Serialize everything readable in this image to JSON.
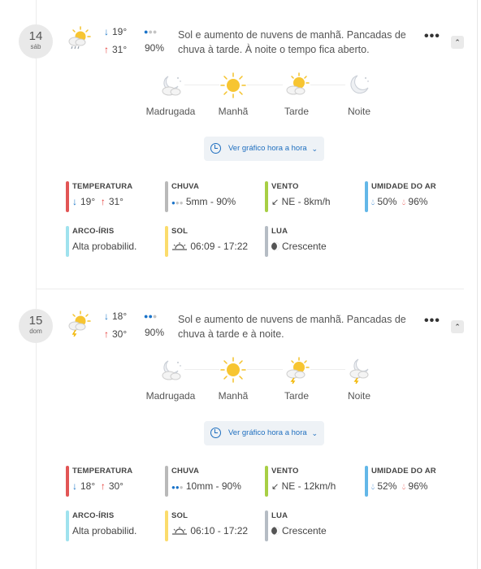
{
  "colors": {
    "accent": "#1f6fbf",
    "temp_bar": "#e25555",
    "rain_bar": "#b9b9b9",
    "wind_bar": "#a8cf45",
    "humidity_bar": "#63b7e8",
    "rainbow_bar": "#9fe2ee",
    "sun_bar": "#fbdc6c",
    "moon_bar": "#b5bcc4"
  },
  "days": [
    {
      "day_num": "14",
      "weekday": "sáb",
      "icon": "sun-cloud-rain-icon",
      "min_temp": "19°",
      "max_temp": "31°",
      "rain_drops_filled": 1,
      "rain_pct": "90%",
      "description": "Sol e aumento de nuvens de manhã. Pancadas de chuva à tarde. À noite o tempo fica aberto.",
      "more_label": "•••",
      "collapse_label": "⌃",
      "periods": [
        {
          "label": "Madrugada",
          "icon": "moon-cloud-icon"
        },
        {
          "label": "Manhã",
          "icon": "sun-icon"
        },
        {
          "label": "Tarde",
          "icon": "sun-cloud-icon"
        },
        {
          "label": "Noite",
          "icon": "moon-icon"
        }
      ],
      "hourly_button": "Ver gráfico hora a hora",
      "stats": {
        "temperature": {
          "title": "TEMPERATURA",
          "min": "19°",
          "max": "31°"
        },
        "rain": {
          "title": "CHUVA",
          "value": "5mm - 90%",
          "drops_filled": 1
        },
        "wind": {
          "title": "VENTO",
          "value": "NE - 8km/h"
        },
        "humidity": {
          "title": "UMIDADE DO AR",
          "min": "50%",
          "max": "96%"
        },
        "rainbow": {
          "title": "ARCO-ÍRIS",
          "value": "Alta probabilid."
        },
        "sun": {
          "title": "SOL",
          "value": "06:09 - 17:22"
        },
        "moon": {
          "title": "LUA",
          "value": "Crescente"
        }
      }
    },
    {
      "day_num": "15",
      "weekday": "dom",
      "icon": "sun-cloud-storm-icon",
      "min_temp": "18°",
      "max_temp": "30°",
      "rain_drops_filled": 2,
      "rain_pct": "90%",
      "description": "Sol e aumento de nuvens de manhã. Pancadas de chuva à tarde e à noite.",
      "more_label": "•••",
      "collapse_label": "⌃",
      "periods": [
        {
          "label": "Madrugada",
          "icon": "moon-cloud-icon"
        },
        {
          "label": "Manhã",
          "icon": "sun-icon"
        },
        {
          "label": "Tarde",
          "icon": "sun-cloud-storm-icon"
        },
        {
          "label": "Noite",
          "icon": "moon-cloud-storm-icon"
        }
      ],
      "hourly_button": "Ver gráfico hora a hora",
      "stats": {
        "temperature": {
          "title": "TEMPERATURA",
          "min": "18°",
          "max": "30°"
        },
        "rain": {
          "title": "CHUVA",
          "value": "10mm - 90%",
          "drops_filled": 2
        },
        "wind": {
          "title": "VENTO",
          "value": "NE - 12km/h"
        },
        "humidity": {
          "title": "UMIDADE DO AR",
          "min": "52%",
          "max": "96%"
        },
        "rainbow": {
          "title": "ARCO-ÍRIS",
          "value": "Alta probabilid."
        },
        "sun": {
          "title": "SOL",
          "value": "06:10 - 17:22"
        },
        "moon": {
          "title": "LUA",
          "value": "Crescente"
        }
      }
    }
  ]
}
